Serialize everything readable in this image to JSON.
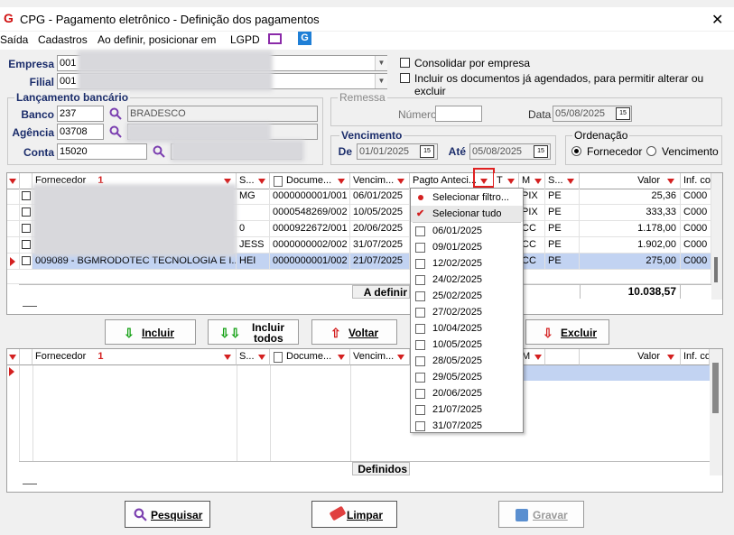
{
  "window": {
    "title": "CPG - Pagamento eletrônico - Definição dos pagamentos",
    "logo": "G"
  },
  "menu": [
    "Saída",
    "Cadastros",
    "Ao definir, posicionar em",
    "LGPD"
  ],
  "empresa": {
    "label": "Empresa",
    "code": "001"
  },
  "filial": {
    "label": "Filial",
    "code": "001"
  },
  "options": {
    "consolidar": "Consolidar por empresa",
    "incluir_agendados": "Incluir os documentos já agendados, para permitir alterar ou excluir"
  },
  "lancamento": {
    "title": "Lançamento bancário",
    "banco_label": "Banco",
    "banco_code": "237",
    "banco_name": "BRADESCO",
    "agencia_label": "Agência",
    "agencia_code": "03708",
    "conta_label": "Conta",
    "conta_code": "15020"
  },
  "remessa": {
    "title": "Remessa",
    "numero_label": "Número",
    "numero_value": "",
    "data_label": "Data",
    "data_value": "05/08/2025"
  },
  "vencimento": {
    "title": "Vencimento",
    "de_label": "De",
    "de_value": "01/01/2025",
    "ate_label": "Até",
    "ate_value": "05/08/2025"
  },
  "ordenacao": {
    "title": "Ordenação",
    "fornecedor": "Fornecedor",
    "vencimento": "Vencimento"
  },
  "top_grid": {
    "headers": {
      "fornecedor": "Fornecedor",
      "sort": "1",
      "s": "S...",
      "documento": "Docume...",
      "vencimento": "Vencim...",
      "pagto": "Pagto Anteci...",
      "t": "T",
      "m": "M",
      "s2": "S...",
      "valor": "Valor",
      "inf": "Inf. co"
    },
    "rows": [
      {
        "fornecedor": "",
        "s": "MG",
        "documento": "0000000001/001",
        "vencimento": "06/01/2025",
        "m": "PIX",
        "s2": "PE",
        "valor": "25,36",
        "inf": "C000"
      },
      {
        "fornecedor": "",
        "s": "",
        "documento": "0000548269/002",
        "vencimento": "10/05/2025",
        "m": "PIX",
        "s2": "PE",
        "valor": "333,33",
        "inf": "C000"
      },
      {
        "fornecedor": "",
        "s": "0",
        "documento": "0000922672/001",
        "vencimento": "20/06/2025",
        "m": "CC",
        "s2": "PE",
        "valor": "1.178,00",
        "inf": "C000"
      },
      {
        "fornecedor": "",
        "s": "JESS",
        "documento": "0000000002/002",
        "vencimento": "31/07/2025",
        "m": "CC",
        "s2": "PE",
        "valor": "1.902,00",
        "inf": "C000"
      },
      {
        "fornecedor": "009089 - BGMRODOTEC TECNOLOGIA E I...",
        "s": "HEI",
        "documento": "0000000001/002",
        "vencimento": "21/07/2025",
        "m": "CC",
        "s2": "PE",
        "valor": "275,00",
        "inf": "C000"
      }
    ],
    "footer_label": "A definir",
    "total": "10.038,57"
  },
  "buttons": {
    "incluir": "Incluir",
    "incluir_todos_1": "Incluir",
    "incluir_todos_2": "todos",
    "voltar": "Voltar",
    "excluir": "Excluir",
    "pesquisar": "Pesquisar",
    "limpar": "Limpar",
    "gravar": "Gravar"
  },
  "bottom_grid": {
    "headers": {
      "fornecedor": "Fornecedor",
      "sort": "1",
      "s": "S...",
      "documento": "Docume...",
      "vencimento": "Vencim...",
      "m": "M",
      "valor": "Valor",
      "inf": "Inf. co"
    },
    "footer_label": "Definidos"
  },
  "filter_dropdown": {
    "select_filter": "Selecionar filtro...",
    "select_all": "Selecionar tudo",
    "dates": [
      "06/01/2025",
      "09/01/2025",
      "12/02/2025",
      "24/02/2025",
      "25/02/2025",
      "27/02/2025",
      "10/04/2025",
      "10/05/2025",
      "28/05/2025",
      "29/05/2025",
      "20/06/2025",
      "21/07/2025",
      "31/07/2025"
    ]
  },
  "colors": {
    "accent_red": "#d42020",
    "label_blue": "#1b2d6b",
    "selection": "#c2d3f2"
  }
}
